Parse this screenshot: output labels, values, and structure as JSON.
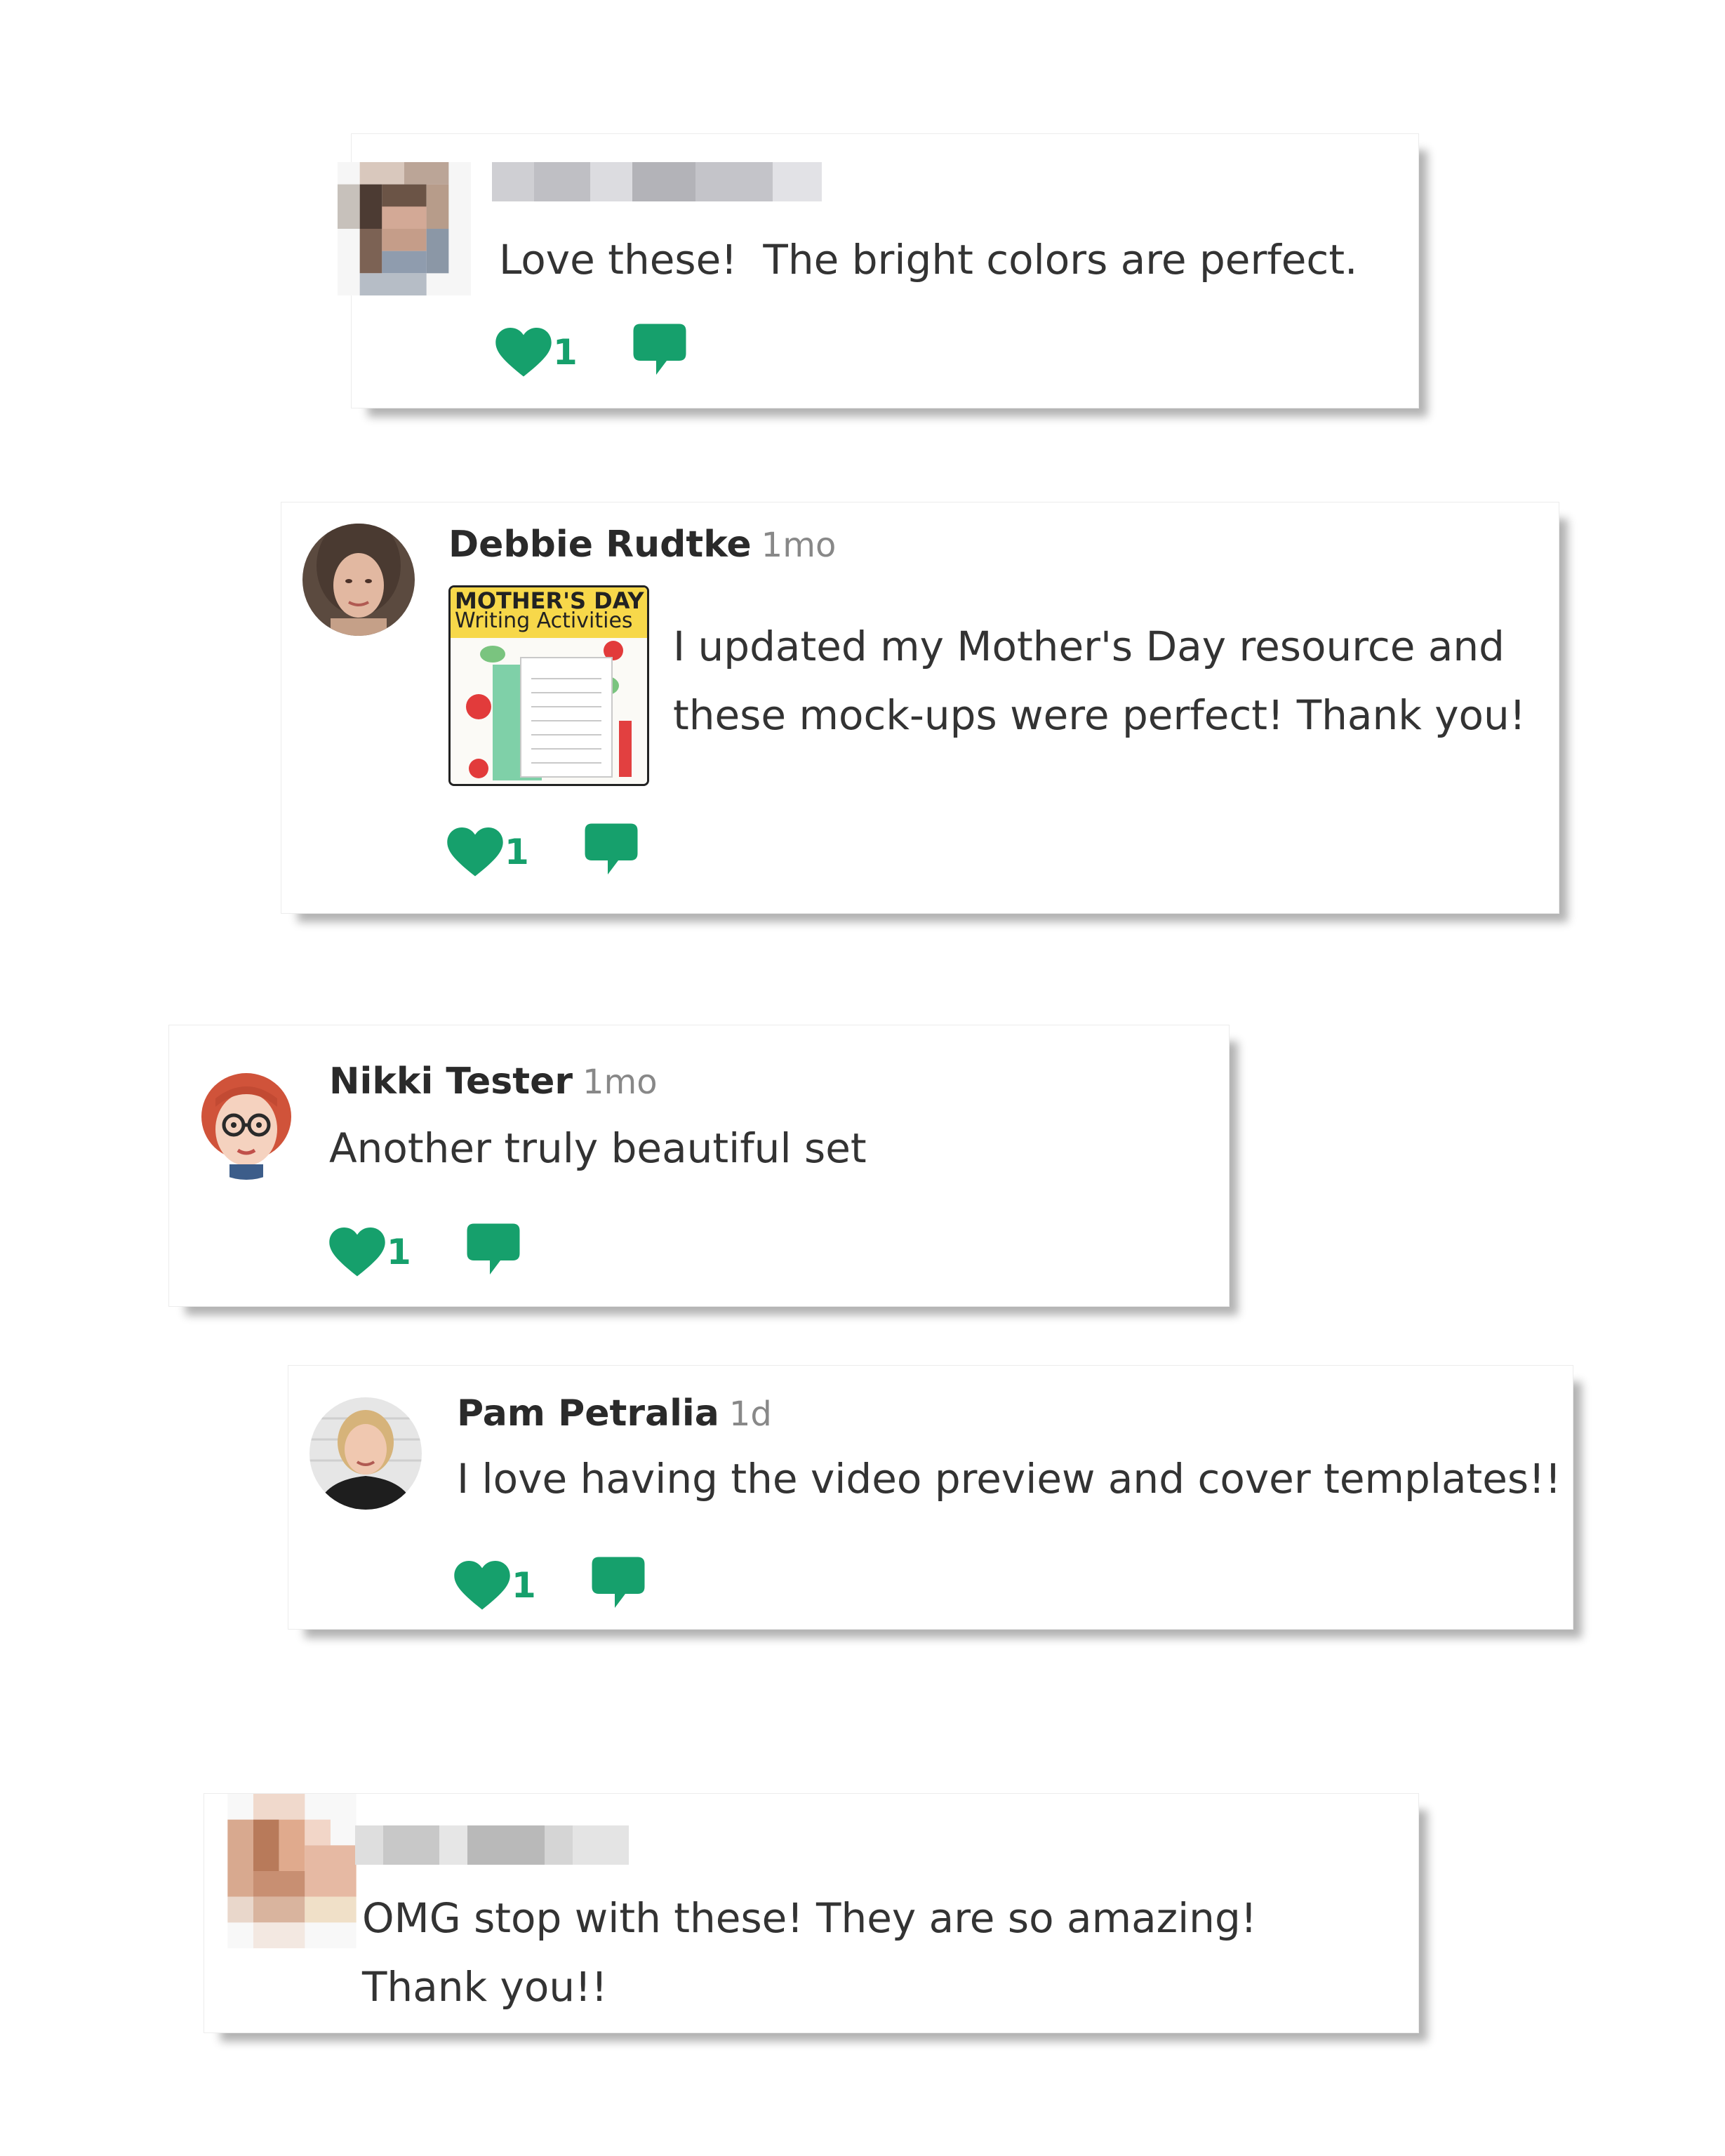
{
  "accent_color": "#16a06c",
  "comments": [
    {
      "name": "",
      "time": "",
      "text": "Love these!  The bright colors are perfect.",
      "likes": "1",
      "avatar": "pixelated-avatar",
      "heart_icon": "heart-icon",
      "reply_icon": "speech-bubble-icon"
    },
    {
      "name": "Debbie Rudtke",
      "time": "1mo",
      "text": "I updated my Mother's Day resource and these mock-ups were perfect!  Thank you!",
      "likes": "1",
      "avatar": "woman-avatar",
      "attachment": {
        "title_line1": "MOTHER'S DAY",
        "title_line2": "Writing Activities"
      },
      "heart_icon": "heart-icon",
      "reply_icon": "speech-bubble-icon"
    },
    {
      "name": "Nikki Tester",
      "time": "1mo",
      "text": "Another truly beautiful set",
      "likes": "1",
      "avatar": "cartoon-avatar",
      "heart_icon": "heart-icon",
      "reply_icon": "speech-bubble-icon"
    },
    {
      "name": "Pam Petralia",
      "time": "1d",
      "text": "I love having the video preview and cover templates!!",
      "likes": "1",
      "avatar": "woman-avatar",
      "heart_icon": "heart-icon",
      "reply_icon": "speech-bubble-icon"
    },
    {
      "name": "",
      "time": "",
      "text": "OMG stop with these! They are so amazing! Thank you!!",
      "likes": "",
      "avatar": "pixelated-avatar"
    }
  ]
}
